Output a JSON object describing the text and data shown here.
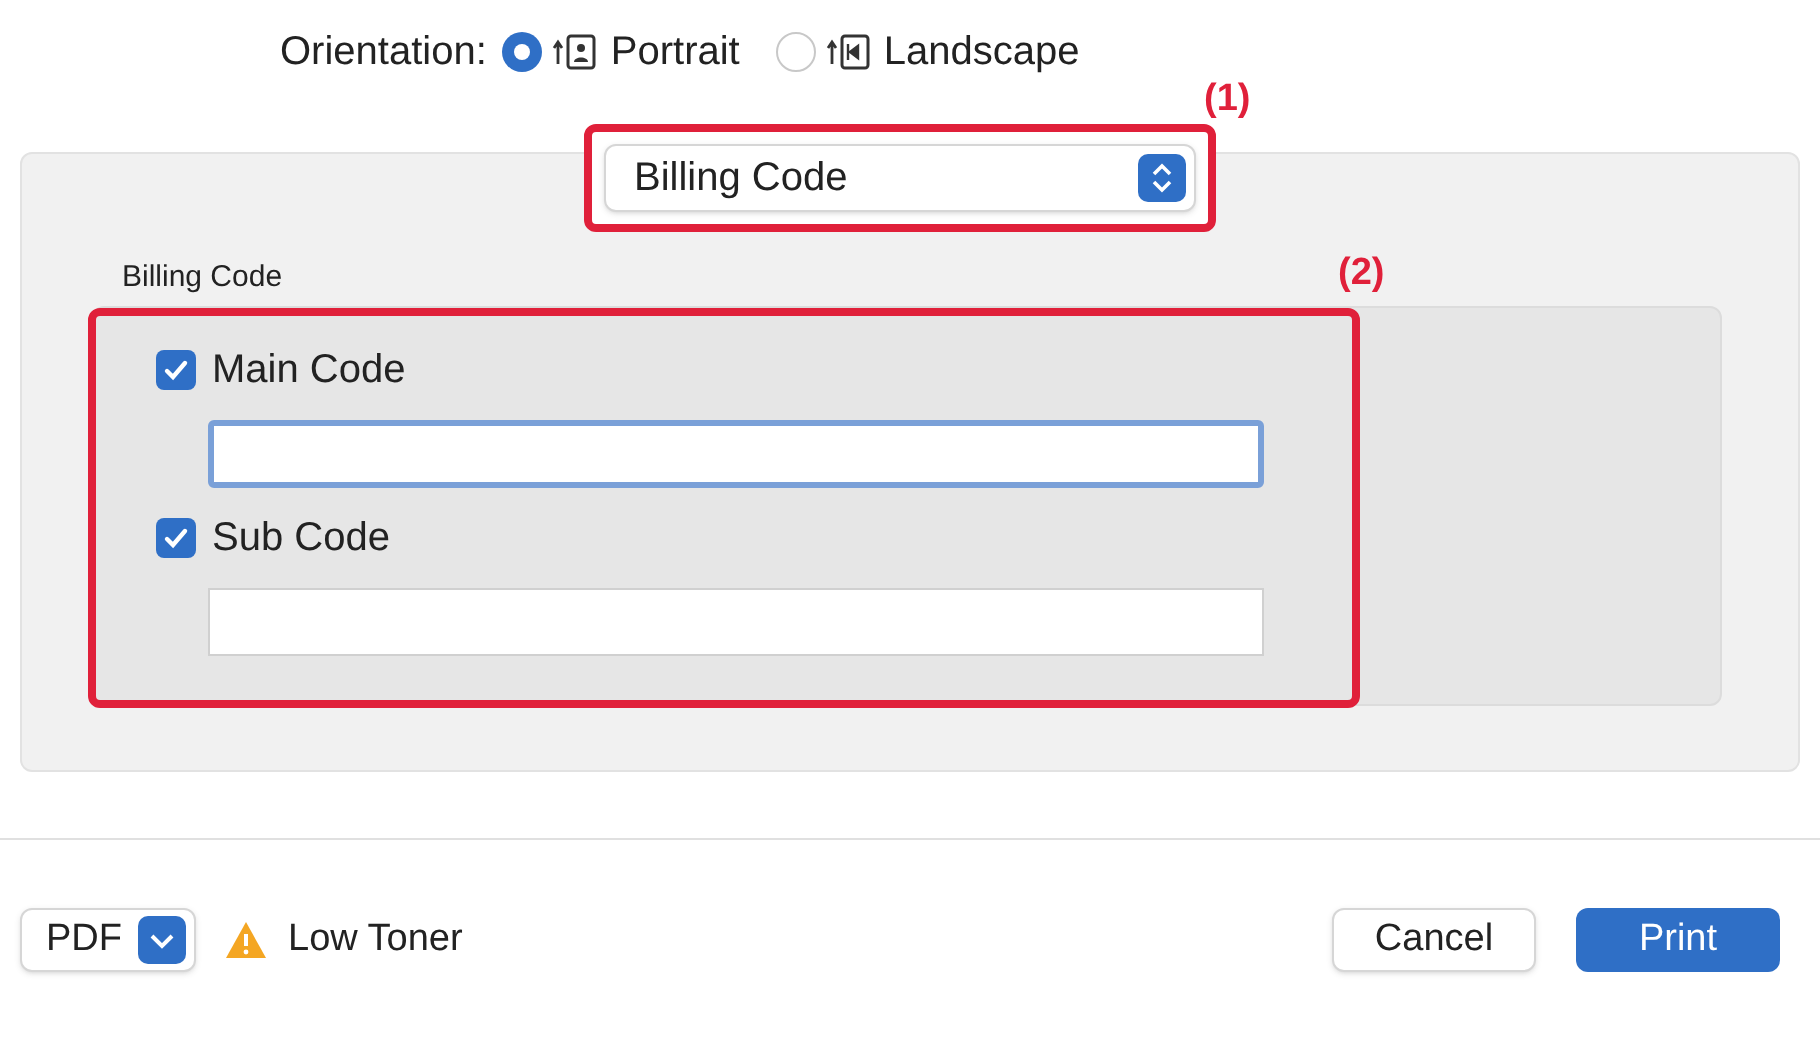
{
  "orientation": {
    "label": "Orientation:",
    "options": [
      {
        "kind": "portrait",
        "label": "Portrait",
        "selected": true
      },
      {
        "kind": "landscape",
        "label": "Landscape",
        "selected": false
      }
    ]
  },
  "popup": {
    "value": "Billing Code",
    "callout": "(1)"
  },
  "group": {
    "title": "Billing Code",
    "callout": "(2)",
    "fields": [
      {
        "label": "Main Code",
        "checked": true,
        "focused": true
      },
      {
        "label": "Sub Code",
        "checked": true,
        "focused": false
      }
    ]
  },
  "footer": {
    "pdf": "PDF",
    "warning": "Low Toner",
    "buttons": [
      {
        "label": "Cancel",
        "kind": "secondary"
      },
      {
        "label": "Print",
        "kind": "primary"
      }
    ]
  }
}
